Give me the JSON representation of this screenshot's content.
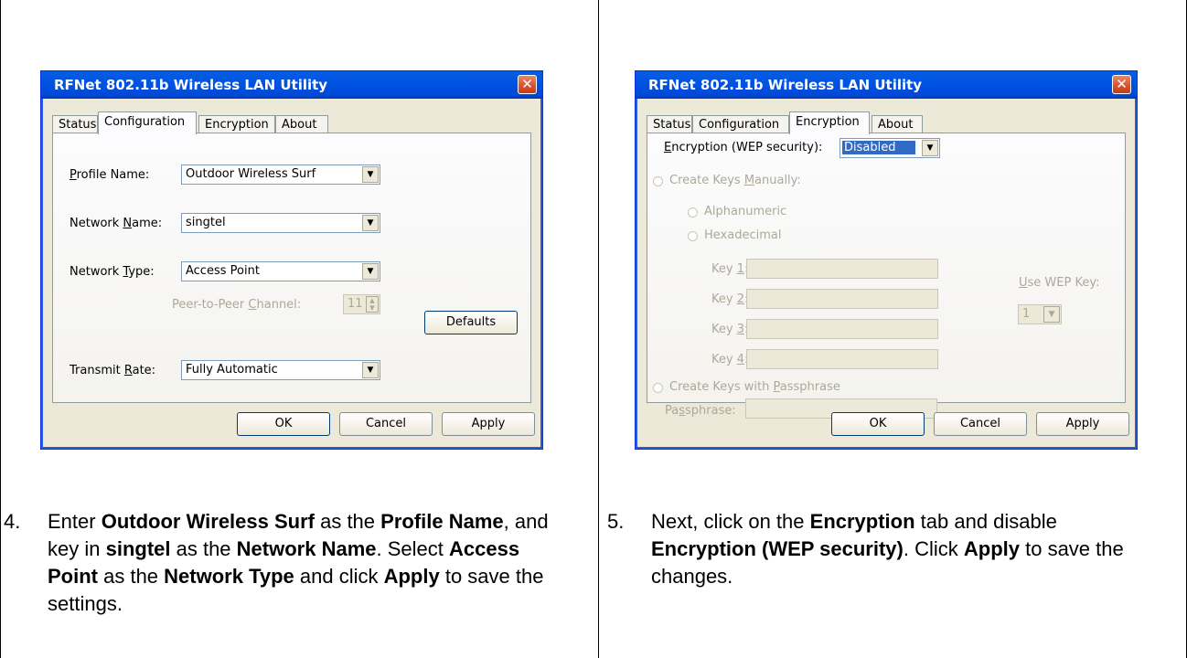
{
  "left_panel": {
    "dialog_title": "RFNet 802.11b Wireless LAN Utility",
    "close_glyph": "✕",
    "tabs": [
      "Status",
      "Configuration",
      "Encryption",
      "About"
    ],
    "active_tab": "Configuration",
    "profile_label": "Profile Name:",
    "profile_value": "Outdoor Wireless Surf",
    "network_name_label": "Network Name:",
    "network_name_value": "singtel",
    "network_type_label": "Network Type:",
    "network_type_value": "Access Point",
    "channel_label": "Peer-to-Peer Channel:",
    "channel_value": "11",
    "defaults_button": "Defaults",
    "transmit_label": "Transmit Rate:",
    "transmit_value": "Fully Automatic",
    "ok_button": "OK",
    "cancel_button": "Cancel",
    "apply_button": "Apply",
    "step_number": "4.",
    "instruction_parts": [
      "Enter ",
      "Outdoor Wireless Surf",
      " as the ",
      "Profile Name",
      ", and key in ",
      "singtel",
      " as the ",
      "Network Name",
      ".  Select ",
      "Access Point",
      " as the ",
      "Network Type",
      " and click ",
      "Apply",
      " to save the settings."
    ]
  },
  "right_panel": {
    "dialog_title": "RFNet 802.11b Wireless LAN Utility",
    "close_glyph": "✕",
    "tabs": [
      "Status",
      "Configuration",
      "Encryption",
      "About"
    ],
    "active_tab": "Encryption",
    "encryption_label": "Encryption (WEP security):",
    "encryption_value": "Disabled",
    "create_manual_label": "Create Keys Manually:",
    "alphanumeric_label": "Alphanumeric",
    "hexadecimal_label": "Hexadecimal",
    "key_labels": [
      "Key 1:",
      "Key 2:",
      "Key 3:",
      "Key 4:"
    ],
    "use_wep_label": "Use WEP Key:",
    "use_wep_value": "1",
    "passphrase_radio_label": "Create Keys with Passphrase",
    "passphrase_label": "Passphrase:",
    "ok_button": "OK",
    "cancel_button": "Cancel",
    "apply_button": "Apply",
    "step_number": "5.",
    "instruction_parts": [
      "Next, click on the ",
      "Encryption",
      " tab and disable ",
      "Encryption (WEP security)",
      ".  Click ",
      "Apply",
      " to save the changes."
    ]
  }
}
